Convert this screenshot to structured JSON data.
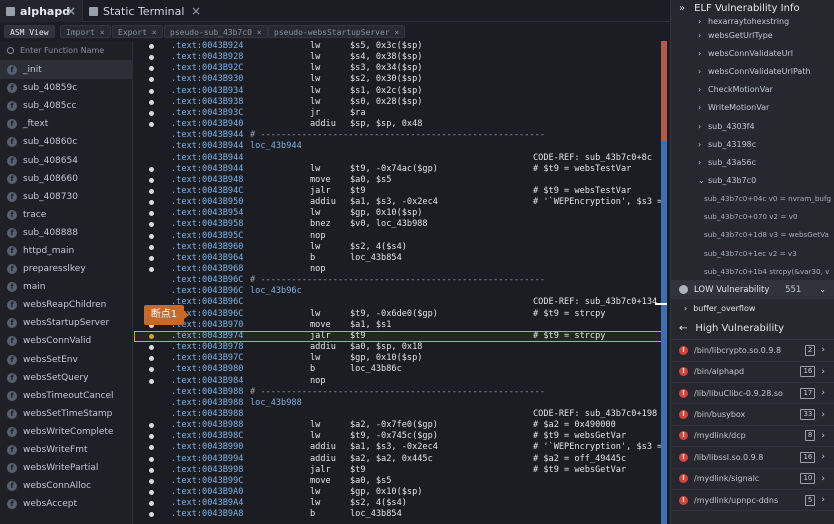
{
  "tabs": [
    {
      "label": "alphapd",
      "close": "×"
    },
    {
      "label": "Static Terminal",
      "close": "×"
    }
  ],
  "subtabs": [
    {
      "label": "ASM View"
    },
    {
      "label": "Import ×"
    },
    {
      "label": "Export ×"
    },
    {
      "label": "pseudo-sub_43b7c0 ×"
    },
    {
      "label": "pseudo-websStartupServer ×"
    }
  ],
  "functions": {
    "search_placeholder": "Enter Function Name",
    "items": [
      "_init",
      "sub_40859c",
      "sub_4085cc",
      "_ftext",
      "sub_40860c",
      "sub_408654",
      "sub_408660",
      "sub_408730",
      "trace",
      "sub_408888",
      "httpd_main",
      "preparesslkey",
      "main",
      "websReapChildren",
      "websStartupServer",
      "websConnValid",
      "websSetEnv",
      "websSetQuery",
      "websTimeoutCancel",
      "websSetTimeStamp",
      "websWriteComplete",
      "websWriteFmt",
      "websWritePartial",
      "websConnAlloc",
      "websAccept"
    ]
  },
  "asm": [
    {
      "a": ".text:0043B924",
      "i": "lw",
      "o": "$s5, 0x3c($sp)"
    },
    {
      "a": ".text:0043B928",
      "i": "lw",
      "o": "$s4, 0x38($sp)"
    },
    {
      "a": ".text:0043B92C",
      "i": "lw",
      "o": "$s3, 0x34($sp)"
    },
    {
      "a": ".text:0043B930",
      "i": "lw",
      "o": "$s2, 0x30($sp)"
    },
    {
      "a": ".text:0043B934",
      "i": "lw",
      "o": "$s1, 0x2c($sp)"
    },
    {
      "a": ".text:0043B938",
      "i": "lw",
      "o": "$s0, 0x28($sp)"
    },
    {
      "a": ".text:0043B93C",
      "i": "jr",
      "o": "$ra"
    },
    {
      "a": ".text:0043B940",
      "i": "addiu",
      "o": "$sp, $sp, 0x48"
    },
    {
      "a": ".text:0043B944",
      "sep": "# -------------------------------------------------------"
    },
    {
      "a": ".text:0043B944",
      "lbl": "loc_43b944"
    },
    {
      "a": ".text:0043B944",
      "c": "CODE-REF: sub_43b7c0+8c"
    },
    {
      "a": ".text:0043B944",
      "i": "lw",
      "o": "$t9, -0x74ac($gp)",
      "c": "# $t9 = websTestVar"
    },
    {
      "a": ".text:0043B948",
      "i": "move",
      "o": "$a0, $s5"
    },
    {
      "a": ".text:0043B94C",
      "i": "jalr",
      "o": "$t9",
      "c": "# $t9 = websTestVar"
    },
    {
      "a": ".text:0043B950",
      "i": "addiu",
      "o": "$a1, $s3, -0x2ec4",
      "c": "# '`WEPEncryption', $s3 ="
    },
    {
      "a": ".text:0043B954",
      "i": "lw",
      "o": "$gp, 0x10($sp)"
    },
    {
      "a": ".text:0043B958",
      "i": "bnez",
      "o": "$v0, loc_43b988"
    },
    {
      "a": ".text:0043B95C",
      "i": "nop",
      "o": ""
    },
    {
      "a": ".text:0043B960",
      "i": "lw",
      "o": "$s2, 4($s4)"
    },
    {
      "a": ".text:0043B964",
      "i": "b",
      "o": "loc_43b854"
    },
    {
      "a": ".text:0043B968",
      "i": "nop",
      "o": ""
    },
    {
      "a": ".text:0043B96C",
      "sep": "# -------------------------------------------------------"
    },
    {
      "a": ".text:0043B96C",
      "lbl": "loc_43b96c"
    },
    {
      "a": ".text:0043B96C",
      "c": "CODE-REF: sub_43b7c0+134"
    },
    {
      "a": ".text:0043B96C",
      "i": "lw",
      "o": "$t9, -0x6de0($gp)",
      "c": "# $t9 = strcpy"
    },
    {
      "a": ".text:0043B970",
      "i": "move",
      "o": "$a1, $s1"
    },
    {
      "a": ".text:0043B974",
      "i": "jalr",
      "o": "$t9",
      "c": "# $t9 = strcpy",
      "hl": true
    },
    {
      "a": ".text:0043B978",
      "i": "addiu",
      "o": "$a0, $sp, 0x18"
    },
    {
      "a": ".text:0043B97C",
      "i": "lw",
      "o": "$gp, 0x10($sp)"
    },
    {
      "a": ".text:0043B980",
      "i": "b",
      "o": "loc_43b86c"
    },
    {
      "a": ".text:0043B984",
      "i": "nop",
      "o": ""
    },
    {
      "a": ".text:0043B988",
      "sep": "# -------------------------------------------------------"
    },
    {
      "a": ".text:0043B988",
      "lbl": "loc_43b988"
    },
    {
      "a": ".text:0043B988",
      "c": "CODE-REF: sub_43b7c0+198"
    },
    {
      "a": ".text:0043B988",
      "i": "lw",
      "o": "$a2, -0x7fe0($gp)",
      "c": "# $a2 = 0x490000"
    },
    {
      "a": ".text:0043B98C",
      "i": "lw",
      "o": "$t9, -0x745c($gp)",
      "c": "# $t9 = websGetVar"
    },
    {
      "a": ".text:0043B990",
      "i": "addiu",
      "o": "$a1, $s3, -0x2ec4",
      "c": "# '`WEPEncryption', $s3 ="
    },
    {
      "a": ".text:0043B994",
      "i": "addiu",
      "o": "$a2, $a2, 0x445c",
      "c": "# $a2 = off_49445c"
    },
    {
      "a": ".text:0043B998",
      "i": "jalr",
      "o": "$t9",
      "c": "# $t9 = websGetVar"
    },
    {
      "a": ".text:0043B99C",
      "i": "move",
      "o": "$a0, $s5"
    },
    {
      "a": ".text:0043B9A0",
      "i": "lw",
      "o": "$gp, 0x10($sp)"
    },
    {
      "a": ".text:0043B9A4",
      "i": "lw",
      "o": "$s2, 4($s4)"
    },
    {
      "a": ".text:0043B9A8",
      "i": "b",
      "o": "loc_43b854"
    }
  ],
  "breakpoint": {
    "label": "断点1"
  },
  "elf_panel": {
    "title": "ELF Vulnerability Info",
    "tree": [
      "hexarraytohexstring",
      "websGetUrlType",
      "websConnValidateUrl",
      "websConnValidateUrlPath",
      "CheckMotionVar",
      "WriteMotionVar",
      "sub_4303f4",
      "sub_43198c",
      "sub_43a56c",
      "sub_43b7c0"
    ],
    "leaves": [
      "sub_43b7c0+04c  v0 = nvram_bufg",
      "sub_43b7c0+070  v2 = v0",
      "sub_43b7c0+1d8  v3 = websGetVa",
      "sub_43b7c0+1ec  v2 = v3",
      "sub_43b7c0+1b4  strcpy(&var30, v"
    ],
    "low_label": "LOW Vulnerability",
    "low_count": "551",
    "buffer_overflow": "buffer_overflow",
    "high_label": "High Vulnerability",
    "high_items": [
      {
        "path": "/bin/libcrypto.so.0.9.8",
        "count": "2"
      },
      {
        "path": "/bin/alphapd",
        "count": "16"
      },
      {
        "path": "/lib/libuClibc-0.9.28.so",
        "count": "17"
      },
      {
        "path": "/bin/busybox",
        "count": "33"
      },
      {
        "path": "/mydlink/dcp",
        "count": "8"
      },
      {
        "path": "/lib/libssl.so.0.9.8",
        "count": "16"
      },
      {
        "path": "/mydlink/signalc",
        "count": "10"
      },
      {
        "path": "/mydlink/upnpc-ddns",
        "count": "5"
      }
    ]
  }
}
